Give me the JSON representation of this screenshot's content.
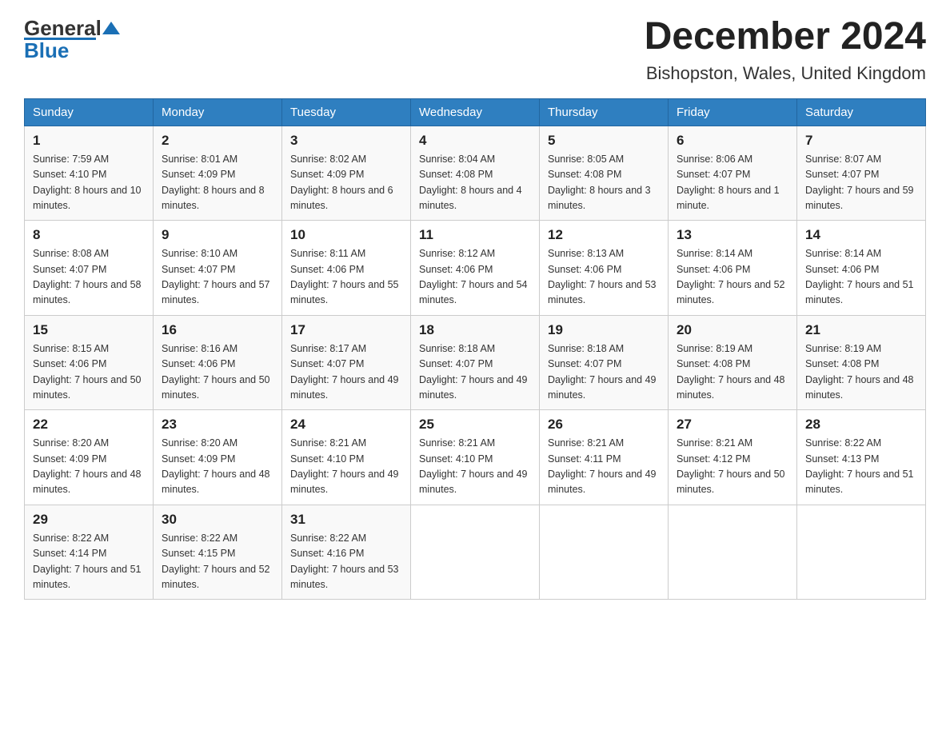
{
  "logo": {
    "general": "General",
    "blue": "Blue"
  },
  "title": "December 2024",
  "subtitle": "Bishopston, Wales, United Kingdom",
  "days_of_week": [
    "Sunday",
    "Monday",
    "Tuesday",
    "Wednesday",
    "Thursday",
    "Friday",
    "Saturday"
  ],
  "weeks": [
    [
      {
        "day": "1",
        "sunrise": "7:59 AM",
        "sunset": "4:10 PM",
        "daylight": "8 hours and 10 minutes."
      },
      {
        "day": "2",
        "sunrise": "8:01 AM",
        "sunset": "4:09 PM",
        "daylight": "8 hours and 8 minutes."
      },
      {
        "day": "3",
        "sunrise": "8:02 AM",
        "sunset": "4:09 PM",
        "daylight": "8 hours and 6 minutes."
      },
      {
        "day": "4",
        "sunrise": "8:04 AM",
        "sunset": "4:08 PM",
        "daylight": "8 hours and 4 minutes."
      },
      {
        "day": "5",
        "sunrise": "8:05 AM",
        "sunset": "4:08 PM",
        "daylight": "8 hours and 3 minutes."
      },
      {
        "day": "6",
        "sunrise": "8:06 AM",
        "sunset": "4:07 PM",
        "daylight": "8 hours and 1 minute."
      },
      {
        "day": "7",
        "sunrise": "8:07 AM",
        "sunset": "4:07 PM",
        "daylight": "7 hours and 59 minutes."
      }
    ],
    [
      {
        "day": "8",
        "sunrise": "8:08 AM",
        "sunset": "4:07 PM",
        "daylight": "7 hours and 58 minutes."
      },
      {
        "day": "9",
        "sunrise": "8:10 AM",
        "sunset": "4:07 PM",
        "daylight": "7 hours and 57 minutes."
      },
      {
        "day": "10",
        "sunrise": "8:11 AM",
        "sunset": "4:06 PM",
        "daylight": "7 hours and 55 minutes."
      },
      {
        "day": "11",
        "sunrise": "8:12 AM",
        "sunset": "4:06 PM",
        "daylight": "7 hours and 54 minutes."
      },
      {
        "day": "12",
        "sunrise": "8:13 AM",
        "sunset": "4:06 PM",
        "daylight": "7 hours and 53 minutes."
      },
      {
        "day": "13",
        "sunrise": "8:14 AM",
        "sunset": "4:06 PM",
        "daylight": "7 hours and 52 minutes."
      },
      {
        "day": "14",
        "sunrise": "8:14 AM",
        "sunset": "4:06 PM",
        "daylight": "7 hours and 51 minutes."
      }
    ],
    [
      {
        "day": "15",
        "sunrise": "8:15 AM",
        "sunset": "4:06 PM",
        "daylight": "7 hours and 50 minutes."
      },
      {
        "day": "16",
        "sunrise": "8:16 AM",
        "sunset": "4:06 PM",
        "daylight": "7 hours and 50 minutes."
      },
      {
        "day": "17",
        "sunrise": "8:17 AM",
        "sunset": "4:07 PM",
        "daylight": "7 hours and 49 minutes."
      },
      {
        "day": "18",
        "sunrise": "8:18 AM",
        "sunset": "4:07 PM",
        "daylight": "7 hours and 49 minutes."
      },
      {
        "day": "19",
        "sunrise": "8:18 AM",
        "sunset": "4:07 PM",
        "daylight": "7 hours and 49 minutes."
      },
      {
        "day": "20",
        "sunrise": "8:19 AM",
        "sunset": "4:08 PM",
        "daylight": "7 hours and 48 minutes."
      },
      {
        "day": "21",
        "sunrise": "8:19 AM",
        "sunset": "4:08 PM",
        "daylight": "7 hours and 48 minutes."
      }
    ],
    [
      {
        "day": "22",
        "sunrise": "8:20 AM",
        "sunset": "4:09 PM",
        "daylight": "7 hours and 48 minutes."
      },
      {
        "day": "23",
        "sunrise": "8:20 AM",
        "sunset": "4:09 PM",
        "daylight": "7 hours and 48 minutes."
      },
      {
        "day": "24",
        "sunrise": "8:21 AM",
        "sunset": "4:10 PM",
        "daylight": "7 hours and 49 minutes."
      },
      {
        "day": "25",
        "sunrise": "8:21 AM",
        "sunset": "4:10 PM",
        "daylight": "7 hours and 49 minutes."
      },
      {
        "day": "26",
        "sunrise": "8:21 AM",
        "sunset": "4:11 PM",
        "daylight": "7 hours and 49 minutes."
      },
      {
        "day": "27",
        "sunrise": "8:21 AM",
        "sunset": "4:12 PM",
        "daylight": "7 hours and 50 minutes."
      },
      {
        "day": "28",
        "sunrise": "8:22 AM",
        "sunset": "4:13 PM",
        "daylight": "7 hours and 51 minutes."
      }
    ],
    [
      {
        "day": "29",
        "sunrise": "8:22 AM",
        "sunset": "4:14 PM",
        "daylight": "7 hours and 51 minutes."
      },
      {
        "day": "30",
        "sunrise": "8:22 AM",
        "sunset": "4:15 PM",
        "daylight": "7 hours and 52 minutes."
      },
      {
        "day": "31",
        "sunrise": "8:22 AM",
        "sunset": "4:16 PM",
        "daylight": "7 hours and 53 minutes."
      },
      null,
      null,
      null,
      null
    ]
  ]
}
